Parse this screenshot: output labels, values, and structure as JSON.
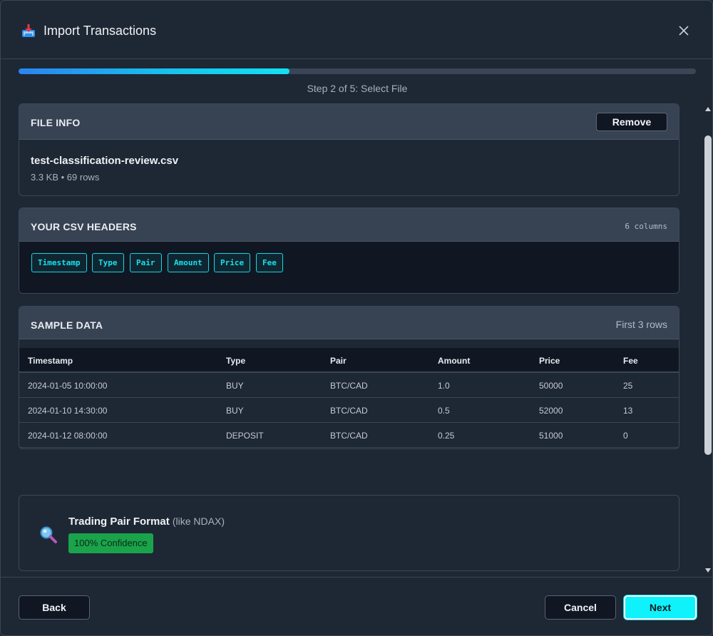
{
  "header": {
    "title": "Import Transactions"
  },
  "progress": {
    "fraction": 0.4,
    "step_text": "Step 2 of 5: Select File"
  },
  "file_info": {
    "heading": "FILE INFO",
    "remove_label": "Remove",
    "file_name": "test-classification-review.csv",
    "file_meta": "3.3 KB • 69 rows"
  },
  "csv_headers": {
    "heading": "YOUR CSV HEADERS",
    "count_text": "6 columns",
    "chips": [
      "Timestamp",
      "Type",
      "Pair",
      "Amount",
      "Price",
      "Fee"
    ]
  },
  "sample_data": {
    "heading": "SAMPLE DATA",
    "rows_hint": "First 3 rows",
    "columns": [
      "Timestamp",
      "Type",
      "Pair",
      "Amount",
      "Price",
      "Fee"
    ],
    "rows": [
      [
        "2024-01-05 10:00:00",
        "BUY",
        "BTC/CAD",
        "1.0",
        "50000",
        "25"
      ],
      [
        "2024-01-10 14:30:00",
        "BUY",
        "BTC/CAD",
        "0.5",
        "52000",
        "13"
      ],
      [
        "2024-01-12 08:00:00",
        "DEPOSIT",
        "BTC/CAD",
        "0.25",
        "51000",
        "0"
      ]
    ]
  },
  "format_detection": {
    "title": "Trading Pair Format",
    "hint": "(like NDAX)",
    "confidence": "100% Confidence"
  },
  "footer": {
    "back_label": "Back",
    "cancel_label": "Cancel",
    "next_label": "Next"
  },
  "colors": {
    "accent": "#10f2fb",
    "chip": "#18e0ef",
    "confidence_bg": "#1aa34a",
    "progress_start": "#2a84f0",
    "progress_end": "#12e1f5"
  },
  "icons": {
    "app": "inbox-tray-icon",
    "close": "close-icon",
    "format": "magnifier-icon"
  }
}
